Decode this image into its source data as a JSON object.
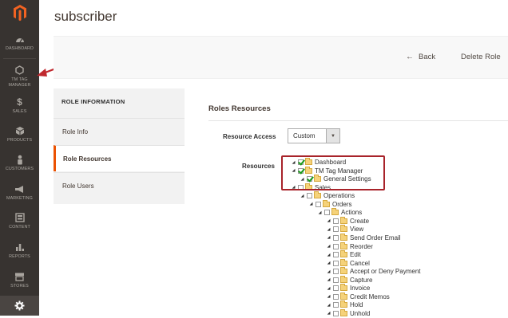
{
  "colors": {
    "sidebar_bg": "#373330",
    "brand": "#eb5202",
    "annotation": "#c0282e",
    "check": "#1a9b1a"
  },
  "sidebar": {
    "logo_icon": "magento-logo-icon",
    "items": [
      {
        "label": "DASHBOARD",
        "icon": "dashboard-icon"
      },
      {
        "label": "TM TAG MANAGER",
        "icon": "hexagon-icon"
      },
      {
        "label": "SALES",
        "icon": "dollar-icon"
      },
      {
        "label": "PRODUCTS",
        "icon": "cube-icon"
      },
      {
        "label": "CUSTOMERS",
        "icon": "person-icon"
      },
      {
        "label": "MARKETING",
        "icon": "megaphone-icon"
      },
      {
        "label": "CONTENT",
        "icon": "content-icon"
      },
      {
        "label": "REPORTS",
        "icon": "bar-chart-icon"
      },
      {
        "label": "STORES",
        "icon": "store-icon"
      },
      {
        "label": "SYSTEM",
        "icon": "gear-icon"
      }
    ]
  },
  "page": {
    "title": "subscriber"
  },
  "actions": {
    "back_icon": "←",
    "back": "Back",
    "delete": "Delete Role"
  },
  "tabs": {
    "title": "ROLE INFORMATION",
    "items": [
      {
        "label": "Role Info",
        "active": false
      },
      {
        "label": "Role Resources",
        "active": true
      },
      {
        "label": "Role Users",
        "active": false
      }
    ]
  },
  "section": {
    "title": "Roles Resources"
  },
  "resource_access": {
    "label": "Resource Access",
    "value": "Custom"
  },
  "resources": {
    "label": "Resources",
    "tree": [
      {
        "label": "Dashboard",
        "checked": true
      },
      {
        "label": "TM Tag Manager",
        "checked": true
      },
      {
        "label": "General Settings",
        "checked": true
      },
      {
        "label": "Sales",
        "checked": false
      },
      {
        "label": "Operations",
        "checked": false
      },
      {
        "label": "Orders",
        "checked": false
      },
      {
        "label": "Actions",
        "checked": false
      },
      {
        "label": "Create",
        "checked": false
      },
      {
        "label": "View",
        "checked": false
      },
      {
        "label": "Send Order Email",
        "checked": false
      },
      {
        "label": "Reorder",
        "checked": false
      },
      {
        "label": "Edit",
        "checked": false
      },
      {
        "label": "Cancel",
        "checked": false
      },
      {
        "label": "Accept or Deny Payment",
        "checked": false
      },
      {
        "label": "Capture",
        "checked": false
      },
      {
        "label": "Invoice",
        "checked": false
      },
      {
        "label": "Credit Memos",
        "checked": false
      },
      {
        "label": "Hold",
        "checked": false
      },
      {
        "label": "Unhold",
        "checked": false
      }
    ]
  }
}
